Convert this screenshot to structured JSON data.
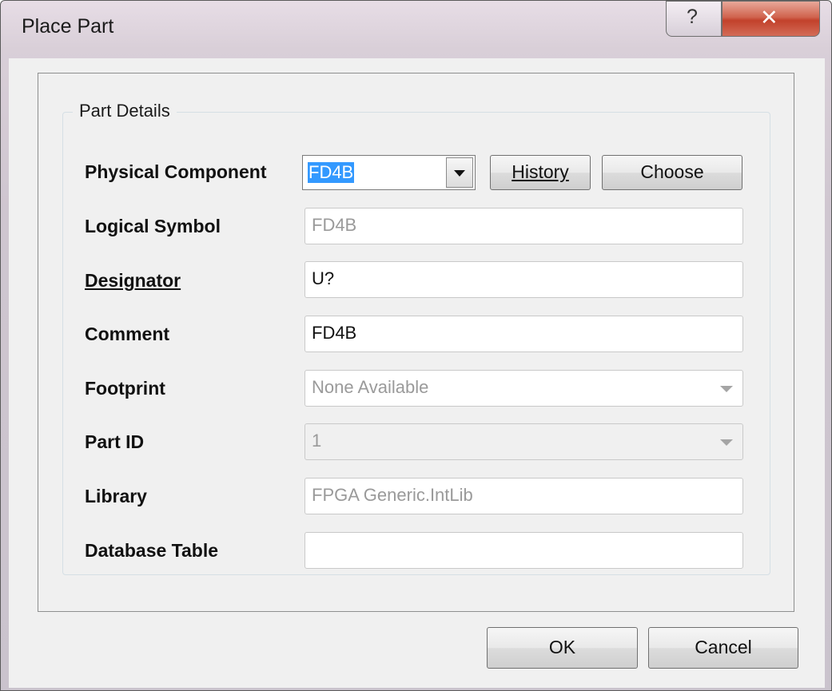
{
  "window": {
    "title": "Place Part",
    "help_glyph": "?",
    "close_glyph": "✕"
  },
  "group": {
    "title": "Part Details"
  },
  "fields": {
    "physical_component": {
      "label": "Physical Component",
      "value": "FD4B",
      "history_label": "History",
      "choose_label": "Choose"
    },
    "logical_symbol": {
      "label": "Logical Symbol",
      "value": "FD4B"
    },
    "designator": {
      "label": "Designator",
      "value": "U?"
    },
    "comment": {
      "label": "Comment",
      "value": "FD4B"
    },
    "footprint": {
      "label": "Footprint",
      "value": "None Available"
    },
    "part_id": {
      "label": "Part ID",
      "value": "1"
    },
    "library": {
      "label": "Library",
      "value": "FPGA Generic.IntLib"
    },
    "database_table": {
      "label": "Database Table",
      "value": ""
    }
  },
  "buttons": {
    "ok": "OK",
    "cancel": "Cancel"
  },
  "colors": {
    "selection": "#3399ff",
    "close_button": "#c94a35"
  }
}
